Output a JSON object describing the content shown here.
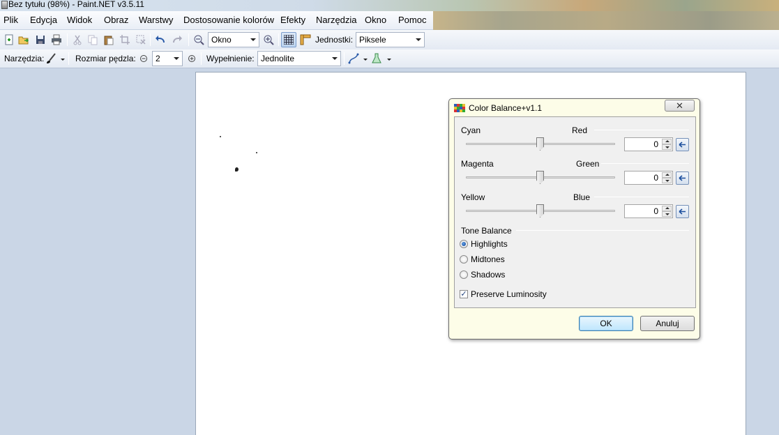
{
  "window": {
    "title": "Bez tytułu (98%) - Paint.NET v3.5.11"
  },
  "menu": [
    "Plik",
    "Edycja",
    "Widok",
    "Obraz",
    "Warstwy",
    "Dostosowanie kolorów",
    "Efekty",
    "Narzędzia",
    "Okno",
    "Pomoc"
  ],
  "toolbar": {
    "zoom_value": "Okno",
    "units_label": "Jednostki:",
    "units_value": "Piksele",
    "tools_label": "Narzędzia:",
    "brush_size_label": "Rozmiar pędzla:",
    "brush_size_value": "2",
    "fill_label": "Wypełnienie:",
    "fill_value": "Jednolite"
  },
  "dialog": {
    "title": "Color Balance+v1.1",
    "close_symbol": "✕",
    "sliders": [
      {
        "left": "Cyan",
        "right": "Red",
        "value": "0",
        "level": 0
      },
      {
        "left": "Magenta",
        "right": "Green",
        "value": "0",
        "level": 0
      },
      {
        "left": "Yellow",
        "right": "Blue",
        "value": "0",
        "level": 0
      }
    ],
    "tone_balance_label": "Tone Balance",
    "tones": [
      "Highlights",
      "Midtones",
      "Shadows"
    ],
    "selected_tone": "Highlights",
    "preserve_label": "Preserve Luminosity",
    "preserve_checked": true,
    "ok_label": "OK",
    "cancel_label": "Anuluj"
  },
  "colors": {
    "accent": "#3c7fb1",
    "app_bg": "#cad6e6"
  }
}
